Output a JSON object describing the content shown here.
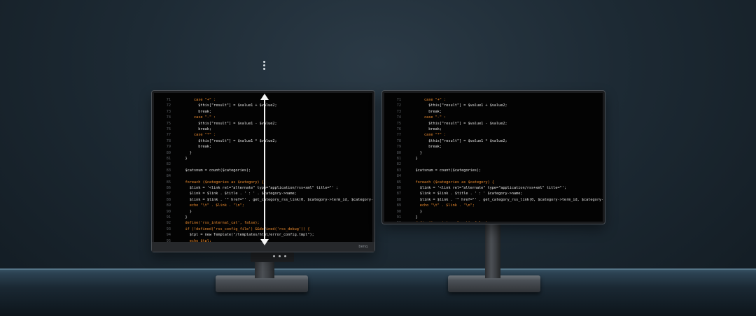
{
  "left_monitor": {
    "brand": "benq",
    "code_lines": [
      {
        "n": "71",
        "t": "        case \"+\" :"
      },
      {
        "n": "72",
        "t": "          $this[\"result\"] = $value1 + $value2;"
      },
      {
        "n": "73",
        "t": "          break;"
      },
      {
        "n": "74",
        "t": "        case \"-\" :"
      },
      {
        "n": "75",
        "t": "          $this[\"result\"] = $value1 - $value2;"
      },
      {
        "n": "76",
        "t": "          break;"
      },
      {
        "n": "77",
        "t": "        case \"*\" :"
      },
      {
        "n": "78",
        "t": "          $this[\"result\"] = $value1 * $value2;"
      },
      {
        "n": "79",
        "t": "          break;"
      },
      {
        "n": "80",
        "t": "      }"
      },
      {
        "n": "81",
        "t": "    }"
      },
      {
        "n": "82",
        "t": ""
      },
      {
        "n": "83",
        "t": "    $catsnum = count($categories);"
      },
      {
        "n": "84",
        "t": ""
      },
      {
        "n": "85",
        "t": "    foreach ($categories as $category) {"
      },
      {
        "n": "86",
        "t": "      $link = '<link rel=\"alternate\" type=\"application/rss+xml\" title=\"' ;"
      },
      {
        "n": "87",
        "t": "      $link = $link . $title . ' : ' . $category->name;"
      },
      {
        "n": "88",
        "t": "      $link = $link . '\" href=\"' . get_category_rss_link(0, $category->term_id, $category->name);"
      },
      {
        "n": "89",
        "t": "      echo \"\\t\" . $link . \"\\n\";"
      },
      {
        "n": "90",
        "t": "      }"
      },
      {
        "n": "91",
        "t": "    }"
      },
      {
        "n": "92",
        "t": "    define('rss_internal_cat', false);"
      },
      {
        "n": "93",
        "t": "    if (!defined('rss_config_file') &&defined('rss_debug')) {"
      },
      {
        "n": "94",
        "t": "      $tpl = new Template(\"/templates/html/error_config.tmpl\");"
      },
      {
        "n": "95",
        "t": "      echo $tpl;"
      }
    ]
  },
  "right_monitor": {
    "code_lines": [
      {
        "n": "71",
        "t": "        case \"+\" :"
      },
      {
        "n": "72",
        "t": "          $this[\"result\"] = $value1 + $value2;"
      },
      {
        "n": "73",
        "t": "          break;"
      },
      {
        "n": "74",
        "t": "        case \"-\" :"
      },
      {
        "n": "75",
        "t": "          $this[\"result\"] = $value1 - $value2;"
      },
      {
        "n": "76",
        "t": "          break;"
      },
      {
        "n": "77",
        "t": "        case \"*\" :"
      },
      {
        "n": "78",
        "t": "          $this[\"result\"] = $value1 * $value2;"
      },
      {
        "n": "79",
        "t": "          break;"
      },
      {
        "n": "80",
        "t": "      }"
      },
      {
        "n": "81",
        "t": "    }"
      },
      {
        "n": "82",
        "t": ""
      },
      {
        "n": "83",
        "t": "    $catsnum = count($categories);"
      },
      {
        "n": "84",
        "t": ""
      },
      {
        "n": "85",
        "t": "    foreach ($categories as $category) {"
      },
      {
        "n": "86",
        "t": "      $link = '<link rel=\"alternate\" type=\"application/rss+xml\" title=\"';"
      },
      {
        "n": "87",
        "t": "      $link = $link . $title . ' : ' $category->name;"
      },
      {
        "n": "88",
        "t": "      $link = $link . '\" href=\"' . get_category_rss_link(0, $category->term_id, $category->name);"
      },
      {
        "n": "89",
        "t": "      echo \"\\t\" . $link . \"\\n\";"
      },
      {
        "n": "90",
        "t": "      }"
      },
      {
        "n": "91",
        "t": "    }"
      },
      {
        "n": "92",
        "t": "    define('rss_internal_cat', false);"
      }
    ]
  },
  "colors": {
    "keyword": "#f18d2e",
    "string": "#d8c26a",
    "code_text": "#e6e6e6",
    "line_number": "#5d6166",
    "screen_bg": "#030303",
    "arrow": "#f5f5f5"
  },
  "icons": [
    "height-adjust-arrow-icon",
    "brand-logo-icon"
  ]
}
